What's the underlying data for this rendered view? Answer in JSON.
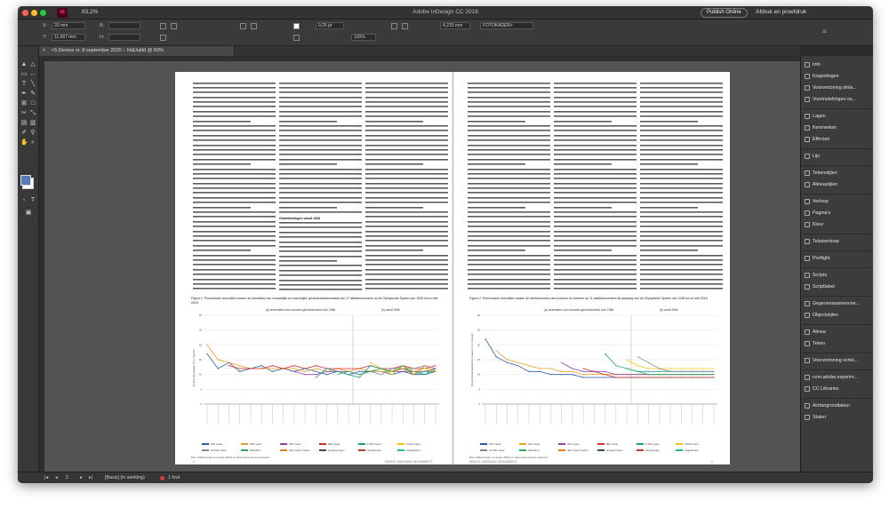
{
  "window": {
    "title": "Adobe InDesign CC 2018",
    "app_mark": "Id",
    "zoom": "83,2%",
    "publish_label": "Publish Online",
    "print_mode": "Afdruk en proefdruk"
  },
  "controlbar": {
    "x_label": "X:",
    "x_value": "33 mm",
    "y_label": "Y:",
    "y_value": "11,667 mm",
    "w_label": "B:",
    "h_label": "H:",
    "stroke_weight": "0,25 pt",
    "opacity": "100%",
    "gap": "4,233 mm",
    "style": "FOTOKADER+"
  },
  "document_tab": {
    "label": "<5 Demos nr. 8 september 2020 – NdiJuldd @ 83%"
  },
  "panels": [
    {
      "label": "Info",
      "icon": "info-icon"
    },
    {
      "label": "Koppelingen",
      "icon": "link-icon"
    },
    {
      "label": "Voorvertoning afvla...",
      "icon": "preview-icon"
    },
    {
      "label": "Voorinstellingen ov...",
      "icon": "preset-icon"
    },
    {
      "label": "Lagen",
      "icon": "layers-icon"
    },
    {
      "label": "Kenmerken",
      "icon": "attributes-icon"
    },
    {
      "label": "Effecten",
      "icon": "fx-icon"
    },
    {
      "label": "Lijn",
      "icon": "stroke-icon"
    },
    {
      "label": "Tekenstijlen",
      "icon": "char-styles-icon"
    },
    {
      "label": "Alineastijlen",
      "icon": "para-styles-icon"
    },
    {
      "label": "Verloop",
      "icon": "gradient-icon"
    },
    {
      "label": "Pagina's",
      "icon": "pages-icon"
    },
    {
      "label": "Kleur",
      "icon": "color-icon"
    },
    {
      "label": "Tekstomloop",
      "icon": "text-wrap-icon"
    },
    {
      "label": "Preflight",
      "icon": "preflight-icon"
    },
    {
      "label": "Scripts",
      "icon": "scripts-icon"
    },
    {
      "label": "Scriptlabel",
      "icon": "script-label-icon"
    },
    {
      "label": "Gegevenssamenvoe...",
      "icon": "data-merge-icon"
    },
    {
      "label": "Objectstijlen",
      "icon": "object-styles-icon"
    },
    {
      "label": "Alinea",
      "icon": "paragraph-icon"
    },
    {
      "label": "Teken",
      "icon": "character-icon"
    },
    {
      "label": "Voorvertoning schei...",
      "icon": "separations-icon"
    },
    {
      "label": "com.adobe.experim...",
      "icon": "experiment-icon"
    },
    {
      "label": "CC Libraries",
      "icon": "libraries-icon"
    },
    {
      "label": "Achtergrondtaken",
      "icon": "background-tasks-icon"
    },
    {
      "label": "Stalen",
      "icon": "swatches-icon"
    }
  ],
  "status": {
    "page": "2",
    "page_style": "[Basis] (in werking)",
    "preflight": "1 fout"
  },
  "spread": {
    "left": {
      "section_head": "Ontwikkelingen vanaf 1928",
      "figure_caption": "Figuur 1. Procentuele verschillen tussen de prestaties van vrouwelijke en mannelijke goudmedaillewinnaars van 17 atletieknummers op de Olympische Spelen van 1928 tot en met 2016",
      "sub_left": "(a) onderdelen voor vrouwen geïntroduceerd vóór 1966",
      "sub_right": "(b) vanaf 1966",
      "source": "Bron: Wallechinsky en Loucky (2012) en https://www.olympic.org/sports",
      "folio_num": "2",
      "folio_text": "DEMOS, JAARGANG 36 NUMMER 8"
    },
    "right": {
      "figure_caption": "Figuur 2. Procentuele verschillen tussen de wereldrecords van vrouwen en mannen op 11 atletieknummers bij aanvang van de Olympische Spelen van 1928 tot en met 2016",
      "sub_left": "(a) onderdelen voor vrouwen geïntroduceerd vóór 1966",
      "sub_right": "(b) vanaf 1966",
      "source": "Bron: Wallechinsky en Loucky (2012) en https://www.olympic.org/sports",
      "folio_num": "3",
      "folio_text": "DEMOS, JAARGANG 36 NUMMER 8"
    }
  },
  "legend_entries": [
    "100 meter",
    "200 meter",
    "400 meter",
    "800 meter",
    "1.500 meter",
    "5.000 meter",
    "10.000 meter",
    "Marathon",
    "400 meter horden",
    "Hoogspringen",
    "Verspringen",
    "Kogelstoten"
  ],
  "colors": {
    "series": [
      "#2a5ba8",
      "#e8a020",
      "#8e44ad",
      "#cf3030",
      "#16a085",
      "#f1c40f",
      "#7f8c8d",
      "#27ae60",
      "#e67e22",
      "#34495e",
      "#c0392b",
      "#1abc9c"
    ]
  },
  "chart_data": [
    {
      "type": "line",
      "title": "Figuur 1",
      "y_axis_label": "% verschil vrouwen t.o.v. mannen",
      "ylim": [
        0,
        30
      ],
      "yticks": [
        0,
        5,
        10,
        15,
        20,
        25,
        30
      ],
      "series": [
        {
          "values": [
            17,
            12,
            14,
            11,
            12,
            13,
            11,
            12,
            11,
            12,
            11,
            10,
            11,
            10,
            11,
            11,
            11,
            10,
            11,
            10,
            10,
            11
          ]
        },
        {
          "values": [
            20,
            15,
            14,
            13,
            12,
            12,
            12,
            12,
            12,
            11,
            12,
            11,
            12,
            11,
            12,
            11,
            11,
            11,
            12,
            11,
            11,
            11
          ]
        },
        {
          "values": [
            null,
            null,
            null,
            null,
            null,
            null,
            null,
            null,
            11,
            10,
            10,
            11,
            11,
            11,
            10,
            11,
            12,
            11,
            11,
            11,
            11,
            12
          ]
        },
        {
          "values": [
            null,
            null,
            13,
            12,
            12,
            12,
            13,
            12,
            13,
            12,
            13,
            12,
            12,
            12,
            12,
            13,
            12,
            12,
            13,
            12,
            12,
            13
          ]
        },
        {
          "values": [
            null,
            null,
            null,
            null,
            null,
            null,
            null,
            null,
            null,
            null,
            9,
            12,
            11,
            10,
            9,
            13,
            12,
            11,
            12,
            11,
            10,
            12
          ]
        },
        {
          "values": [
            null,
            null,
            null,
            null,
            null,
            null,
            null,
            null,
            null,
            null,
            null,
            null,
            null,
            null,
            null,
            14,
            12,
            10,
            13,
            11,
            12,
            11
          ]
        },
        {
          "values": [
            null,
            null,
            null,
            null,
            null,
            null,
            null,
            null,
            null,
            null,
            null,
            null,
            null,
            null,
            null,
            11,
            10,
            12,
            12,
            12,
            13,
            12
          ]
        },
        {
          "values": [
            null,
            null,
            null,
            null,
            null,
            null,
            null,
            null,
            null,
            null,
            null,
            null,
            10,
            11,
            10,
            11,
            12,
            11,
            13,
            10,
            11,
            11
          ]
        },
        {
          "values": [
            null,
            null,
            null,
            null,
            null,
            null,
            null,
            null,
            null,
            null,
            null,
            null,
            null,
            null,
            null,
            null,
            null,
            11,
            12,
            10,
            13,
            11
          ]
        }
      ]
    },
    {
      "type": "line",
      "title": "Figuur 2",
      "y_axis_label": "% verschil wereldrecords vrouwen t.o.v. mannen",
      "ylim": [
        0,
        30
      ],
      "yticks": [
        0,
        5,
        10,
        15,
        20,
        25,
        30
      ],
      "series": [
        {
          "values": [
            22,
            16,
            14,
            13,
            11,
            11,
            10,
            10,
            10,
            9,
            9,
            9,
            9,
            9,
            9,
            9,
            9,
            9,
            9,
            9,
            9,
            9
          ]
        },
        {
          "values": [
            null,
            18,
            15,
            14,
            13,
            12,
            12,
            11,
            11,
            10,
            10,
            10,
            10,
            10,
            10,
            10,
            10,
            10,
            10,
            10,
            10,
            10
          ]
        },
        {
          "values": [
            null,
            null,
            null,
            null,
            null,
            null,
            null,
            14,
            12,
            11,
            11,
            11,
            10,
            10,
            10,
            10,
            10,
            10,
            10,
            10,
            10,
            10
          ]
        },
        {
          "values": [
            null,
            null,
            null,
            null,
            null,
            null,
            null,
            null,
            null,
            12,
            11,
            10,
            9,
            9,
            9,
            9,
            9,
            9,
            9,
            9,
            9,
            9
          ]
        },
        {
          "values": [
            null,
            null,
            null,
            null,
            null,
            null,
            null,
            null,
            null,
            null,
            null,
            17,
            13,
            12,
            11,
            11,
            11,
            11,
            11,
            11,
            11,
            11
          ]
        },
        {
          "values": [
            null,
            null,
            null,
            null,
            null,
            null,
            null,
            null,
            null,
            null,
            null,
            null,
            null,
            15,
            13,
            12,
            12,
            12,
            12,
            12,
            12,
            12
          ]
        },
        {
          "values": [
            null,
            null,
            null,
            null,
            null,
            null,
            null,
            null,
            null,
            null,
            null,
            null,
            null,
            null,
            16,
            14,
            12,
            11,
            11,
            11,
            11,
            11
          ]
        },
        {
          "values": [
            null,
            null,
            null,
            null,
            null,
            null,
            null,
            null,
            null,
            null,
            null,
            null,
            null,
            12,
            11,
            10,
            10,
            10,
            10,
            10,
            10,
            10
          ]
        }
      ]
    }
  ]
}
